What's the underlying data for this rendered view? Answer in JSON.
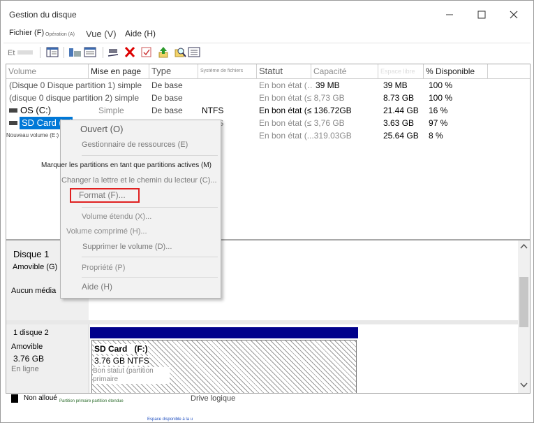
{
  "window": {
    "title": "Gestion du disque",
    "minimize": "—",
    "maximize": "☐",
    "close": "✕"
  },
  "menu": {
    "items": [
      "Fichier (F)",
      "Opération (A)",
      "Vue (V)",
      "Aide (H)"
    ]
  },
  "toolbar": {
    "icons": [
      "back-icon",
      "console-tree-icon",
      "disk-list-icon",
      "properties-icon",
      "connect-icon",
      "delete-icon",
      "check-icon",
      "export-icon",
      "search-icon",
      "settings-list-icon"
    ]
  },
  "volumes": {
    "columns": [
      "Volume",
      "Mise en page",
      "Type",
      "Système de fichiers",
      "Statut",
      "Capacité",
      "Espace libre",
      "% Disponible"
    ],
    "rows": [
      {
        "name": "(Disque 0 Disque partition 1) simple",
        "layout": "",
        "type": "De base",
        "fs": "",
        "status": "En bon état (…",
        "capacity": "39 MB",
        "free": "39 MB",
        "pct": "100 %"
      },
      {
        "name": "(disque 0 disque partition 2) simple",
        "layout": "",
        "type": "De base",
        "fs": "",
        "status": "En bon état (≤ 8,73 GB",
        "capacity": "",
        "free": "8.73 GB",
        "pct": "100 %"
      },
      {
        "name": "OS (C:)",
        "layout": "Simple",
        "type": "De base",
        "fs": "NTFS",
        "status": "En bon état (≤ 136.72GB",
        "capacity": "",
        "free": "21.44 GB",
        "pct": "16 %"
      },
      {
        "name": "SD Card (F:)",
        "layout": "",
        "type": "",
        "fs": "NTFS",
        "status": "En bon état (≤ 3,76 GB",
        "capacity": "",
        "free": "3.63 GB",
        "pct": "97 %"
      },
      {
        "name": "Nouveau volume (E:)",
        "layout": "",
        "type": "",
        "fs": "",
        "status": "En bon état (...319.03GB",
        "capacity": "",
        "free": "25.64 GB",
        "pct": "8 %"
      }
    ]
  },
  "disks": {
    "disk1": {
      "name": "Disque 1",
      "kind": "Amovible (G)",
      "media": "Aucun média"
    },
    "disk2": {
      "name": "1 disque 2",
      "kind": "Amovible",
      "size": "3.76 GB",
      "state": "En ligne",
      "partition": {
        "label": "SD Card",
        "letter": "(F:)",
        "size": "3.76 GB NTFS",
        "status": "Bon statut (partition primaire"
      }
    }
  },
  "legend": {
    "unallocated": "Non alloué",
    "primary": "Partition primaire",
    "extended": "partition étendue",
    "logical": "Drive logique",
    "free": "Espace disponible à la u"
  },
  "context_menu": {
    "open": "Ouvert (O)",
    "explore": "Gestionnaire de ressources (E)",
    "mark_active": "Marquer les partitions en tant que partitions actives (M)",
    "change_letter": "Changer la lettre et le chemin du lecteur (C)...",
    "format": "Format (F)...",
    "extend": "Volume étendu (X)...",
    "shrink": "Volume comprimé (H)...",
    "delete": "Supprimer le volume (D)...",
    "properties": "Propriété (P)",
    "help": "Aide (H)"
  },
  "colors": {
    "selection": "#0078d7",
    "highlight_box": "#e02020",
    "primary_bar": "#00008b"
  }
}
